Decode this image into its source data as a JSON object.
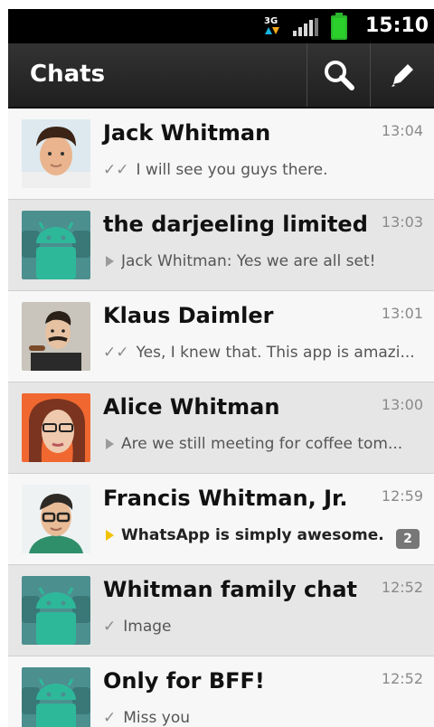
{
  "status_bar": {
    "network_label": "3G",
    "time": "15:10"
  },
  "action_bar": {
    "title": "Chats",
    "search_icon": "search-icon",
    "compose_icon": "pencil-icon"
  },
  "colors": {
    "action_bar": "#2a2a2a",
    "row_light": "#f7f7f7",
    "row_group": "#e6e6e6",
    "android_green": "#2aa887",
    "badge": "#777777"
  },
  "chats": [
    {
      "name": "Jack Whitman",
      "time": "13:04",
      "indicator": "double-check",
      "preview": "I will see you guys there.",
      "avatar": "photo"
    },
    {
      "name": "the darjeeling limited",
      "time": "13:03",
      "indicator": "play",
      "preview": "Jack Whitman: Yes we are all set!",
      "avatar": "group"
    },
    {
      "name": "Klaus Daimler",
      "time": "13:01",
      "indicator": "double-check",
      "preview": "Yes, I knew that. This app is amazi...",
      "avatar": "photo"
    },
    {
      "name": "Alice Whitman",
      "time": "13:00",
      "indicator": "play",
      "preview": "Are we still meeting for coffee tom...",
      "avatar": "photo"
    },
    {
      "name": "Francis Whitman, Jr.",
      "time": "12:59",
      "indicator": "play-unread",
      "preview": "WhatsApp is simply awesome.",
      "unread": "2",
      "avatar": "photo"
    },
    {
      "name": "Whitman family chat",
      "time": "12:52",
      "indicator": "check",
      "preview": "Image",
      "avatar": "group"
    },
    {
      "name": "Only for BFF!",
      "time": "12:52",
      "indicator": "check",
      "preview": "Miss you",
      "avatar": "group"
    }
  ]
}
